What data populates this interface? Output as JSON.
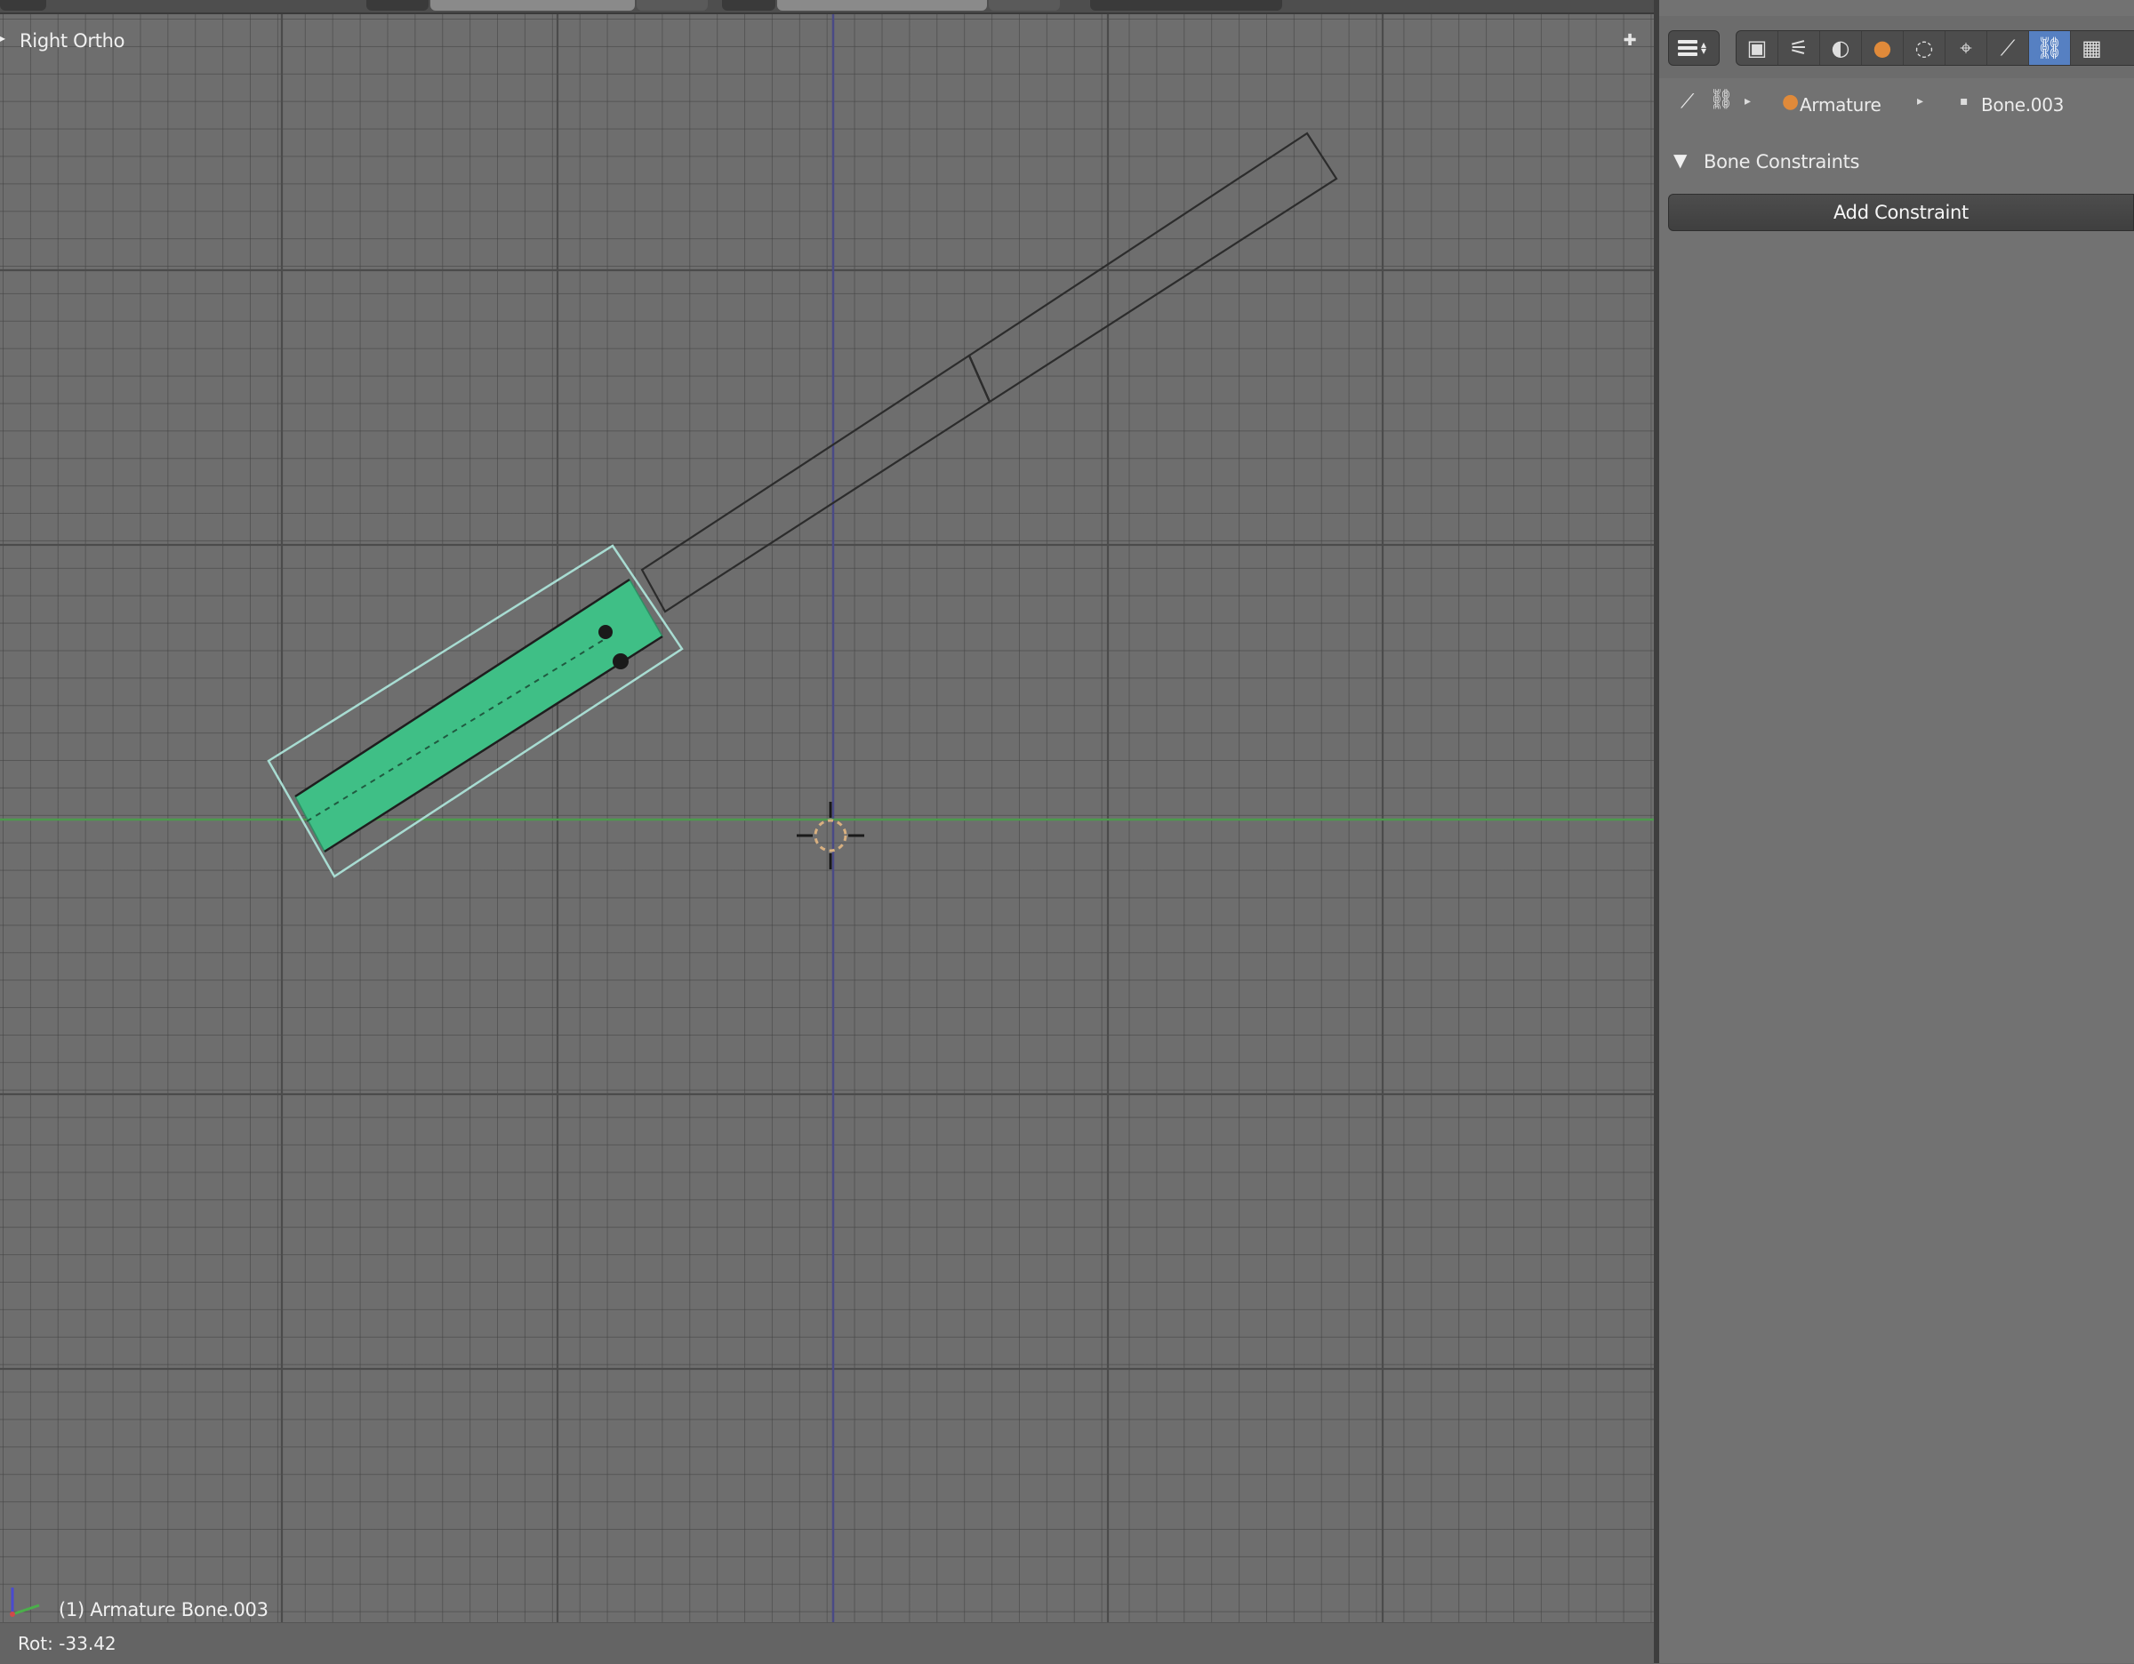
{
  "viewport": {
    "view_label": "Right Ortho",
    "object_info": "(1) Armature Bone.003",
    "corner_widget_icon": "plus-icon",
    "colors": {
      "background": "#6e6e6e",
      "selected_bone_fill": "#3fbf86",
      "selected_bone_outline": "#a8dcd2",
      "y_axis_line": "#4c9a4c",
      "z_axis_line": "#4a4a86"
    }
  },
  "status_bar": {
    "text": "Rot: -33.42"
  },
  "properties": {
    "editor_type_icon": "properties-editor-icon",
    "tabs": [
      {
        "icon": "render-icon",
        "glyph": "▣",
        "active": false
      },
      {
        "icon": "render-layers-icon",
        "glyph": "⚟",
        "active": false
      },
      {
        "icon": "scene-icon",
        "glyph": "◐",
        "active": false
      },
      {
        "icon": "world-icon",
        "glyph": "●",
        "active": false
      },
      {
        "icon": "object-icon",
        "glyph": "◌",
        "active": false
      },
      {
        "icon": "constraints-icon",
        "glyph": "⌖",
        "active": false
      },
      {
        "icon": "bone-icon",
        "glyph": "⟋",
        "active": false
      },
      {
        "icon": "bone-constraints-icon",
        "glyph": "⛓",
        "active": true
      },
      {
        "icon": "texture-icon",
        "glyph": "▦",
        "active": false
      }
    ],
    "breadcrumb": {
      "armature": "Armature",
      "bone": "Bone.003"
    },
    "panel": {
      "title": "Bone Constraints",
      "add_button": "Add Constraint"
    }
  }
}
